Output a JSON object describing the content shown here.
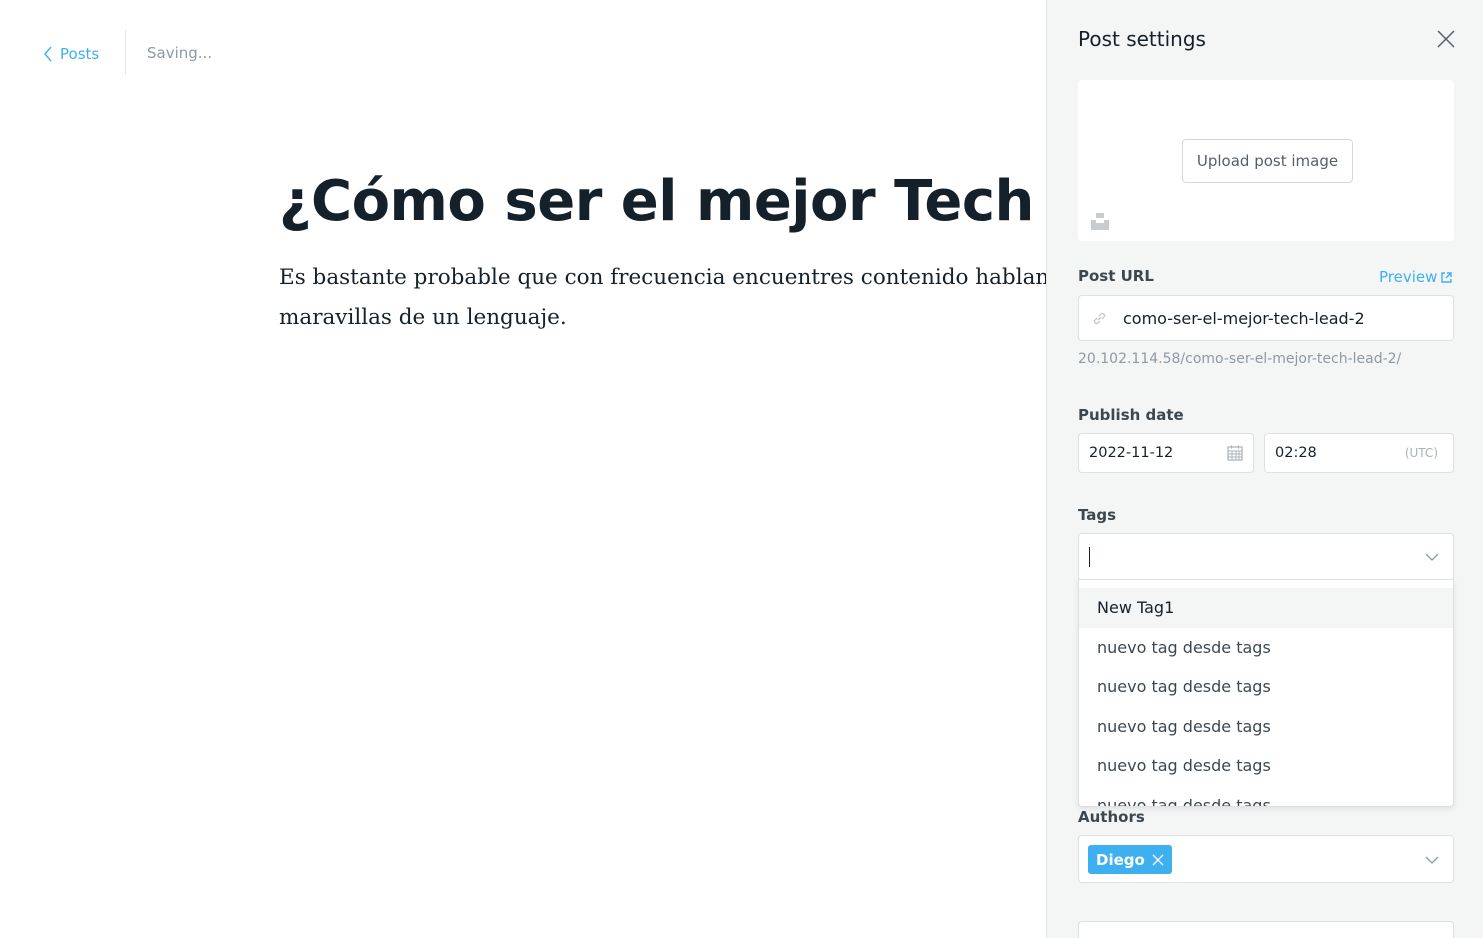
{
  "editor": {
    "back_label": "Posts",
    "save_status": "Saving...",
    "title": "¿Cómo ser el mejor Tech Lead?",
    "body": "Es bastante probable que con frecuencia encuentres contenido hablando de las maravillas de un lenguaje."
  },
  "panel": {
    "title": "Post settings",
    "image": {
      "upload_label": "Upload post image"
    },
    "url": {
      "label": "Post URL",
      "preview_label": "Preview",
      "slug": "como-ser-el-mejor-tech-lead-2",
      "full_url": "20.102.114.58/como-ser-el-mejor-tech-lead-2/"
    },
    "publish": {
      "label": "Publish date",
      "date": "2022-11-12",
      "time": "02:28",
      "timezone": "(UTC)"
    },
    "tags": {
      "label": "Tags",
      "value": "",
      "options": [
        "New Tag1",
        "nuevo tag desde tags",
        "nuevo tag desde tags",
        "nuevo tag desde tags",
        "nuevo tag desde tags",
        "nuevo tag desde tags"
      ]
    },
    "authors": {
      "label": "Authors",
      "selected": [
        "Diego"
      ]
    }
  },
  "colors": {
    "accent": "#3eb0ef",
    "panel_bg": "#f4f5f5",
    "text_dark": "#15212a",
    "text_muted": "#8e9aa3"
  },
  "icons": {
    "back": "chevron-left-icon",
    "close": "close-icon",
    "unsplash": "unsplash-icon",
    "link": "link-icon",
    "external": "external-link-icon",
    "calendar": "calendar-icon",
    "dropdown": "chevron-down-icon",
    "remove": "remove-token-icon"
  }
}
